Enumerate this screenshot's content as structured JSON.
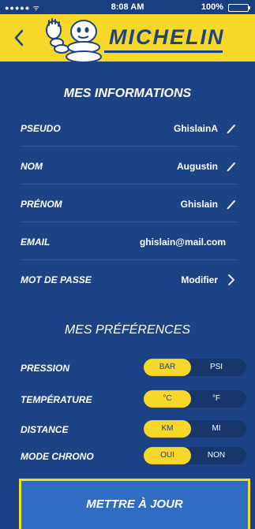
{
  "status_bar": {
    "signal": "●●●●● ᯤ",
    "time": "8:08 AM",
    "battery": "100%"
  },
  "header": {
    "brand": "MICHELIN"
  },
  "info": {
    "title": "MES INFORMATIONS",
    "rows": [
      {
        "label": "PSEUDO",
        "value": "GhislainA",
        "icon": "pencil-icon"
      },
      {
        "label": "NOM",
        "value": "Augustin",
        "icon": "pencil-icon"
      },
      {
        "label": "PRÉNOM",
        "value": "Ghislain",
        "icon": "pencil-icon"
      },
      {
        "label": "EMAIL",
        "value": "ghislain@mail.com",
        "icon": ""
      },
      {
        "label": "MOT DE PASSE",
        "value": "Modifier",
        "icon": "chevron-right-icon"
      }
    ]
  },
  "prefs": {
    "title": "MES PRÉFÉRENCES",
    "rows": [
      {
        "label": "PRESSION",
        "left": "BAR",
        "right": "PSI",
        "selected": "left"
      },
      {
        "label": "TEMPÉRATURE",
        "left": "°C",
        "right": "°F",
        "selected": "left"
      },
      {
        "label": "DISTANCE",
        "left": "KM",
        "right": "MI",
        "selected": "left"
      },
      {
        "label": "MODE CHRONO",
        "left": "OUI",
        "right": "NON",
        "selected": "left"
      }
    ]
  },
  "update_button": {
    "label": "METTRE À JOUR"
  },
  "colors": {
    "background": "#1c4386",
    "accent": "#f7d72a",
    "button": "#2f6cc2",
    "highlight_border": "#f4e017"
  }
}
